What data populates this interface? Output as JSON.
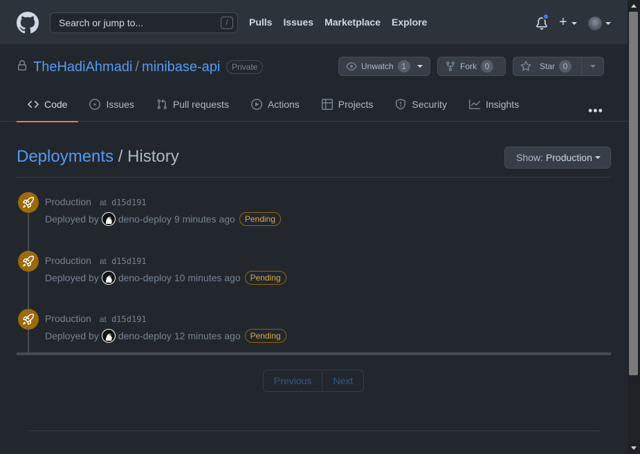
{
  "header": {
    "search_placeholder": "Search or jump to...",
    "search_shortcut": "/",
    "nav": [
      "Pulls",
      "Issues",
      "Marketplace",
      "Explore"
    ],
    "plus": "+"
  },
  "repo": {
    "owner": "TheHadiAhmadi",
    "separator": "/",
    "name": "minibase-api",
    "visibility": "Private",
    "unwatch_label": "Unwatch",
    "unwatch_count": "1",
    "fork_label": "Fork",
    "fork_count": "0",
    "star_label": "Star",
    "star_count": "0",
    "tabs": [
      {
        "label": "Code",
        "icon": "code-icon"
      },
      {
        "label": "Issues",
        "icon": "issue-icon"
      },
      {
        "label": "Pull requests",
        "icon": "pull-request-icon"
      },
      {
        "label": "Actions",
        "icon": "play-icon"
      },
      {
        "label": "Projects",
        "icon": "table-icon"
      },
      {
        "label": "Security",
        "icon": "shield-icon"
      },
      {
        "label": "Insights",
        "icon": "graph-icon"
      }
    ],
    "more": "•••"
  },
  "page": {
    "title_link": "Deployments",
    "title_sep": "/",
    "title_rest": "History",
    "show_label": "Show:",
    "show_value": "Production"
  },
  "deployments": [
    {
      "env": "Production",
      "at": "at",
      "sha": "d15d191",
      "deployed_by": "Deployed by",
      "actor": "deno-deploy",
      "time": "9 minutes ago",
      "status": "Pending"
    },
    {
      "env": "Production",
      "at": "at",
      "sha": "d15d191",
      "deployed_by": "Deployed by",
      "actor": "deno-deploy",
      "time": "10 minutes ago",
      "status": "Pending"
    },
    {
      "env": "Production",
      "at": "at",
      "sha": "d15d191",
      "deployed_by": "Deployed by",
      "actor": "deno-deploy",
      "time": "12 minutes ago",
      "status": "Pending"
    }
  ],
  "pagination": {
    "previous": "Previous",
    "next": "Next"
  },
  "colors": {
    "background": "#22272e",
    "header": "#2d333b",
    "link": "#539bf5",
    "accent_tab": "#ec775c",
    "pending": "#daaa3f",
    "rocket_bg": "#9e6a03"
  }
}
